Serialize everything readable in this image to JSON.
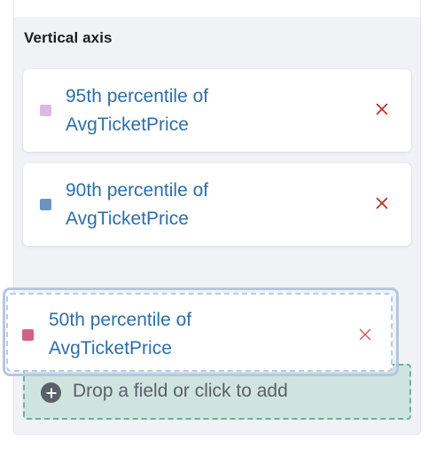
{
  "section": {
    "title": "Vertical axis"
  },
  "dimensions": [
    {
      "label_line1": "95th percentile of",
      "label_line2": "AvgTicketPrice",
      "color": "#dcb9e4",
      "remove_icon": "close-icon"
    },
    {
      "label_line1": "90th percentile of",
      "label_line2": "AvgTicketPrice",
      "color": "#6b92c5",
      "remove_icon": "close-icon"
    }
  ],
  "dragging": {
    "label_line1": "50th percentile of",
    "label_line2": "AvgTicketPrice",
    "color": "#d36086",
    "remove_icon": "close-icon"
  },
  "drop_zone": {
    "text": "Drop a field or click to add",
    "icon": "plus-circle-icon"
  },
  "colors": {
    "link": "#2e6ea8",
    "remove": "#bd271e",
    "drop_bg": "#d0e4df",
    "drop_border": "#6daf9a"
  }
}
